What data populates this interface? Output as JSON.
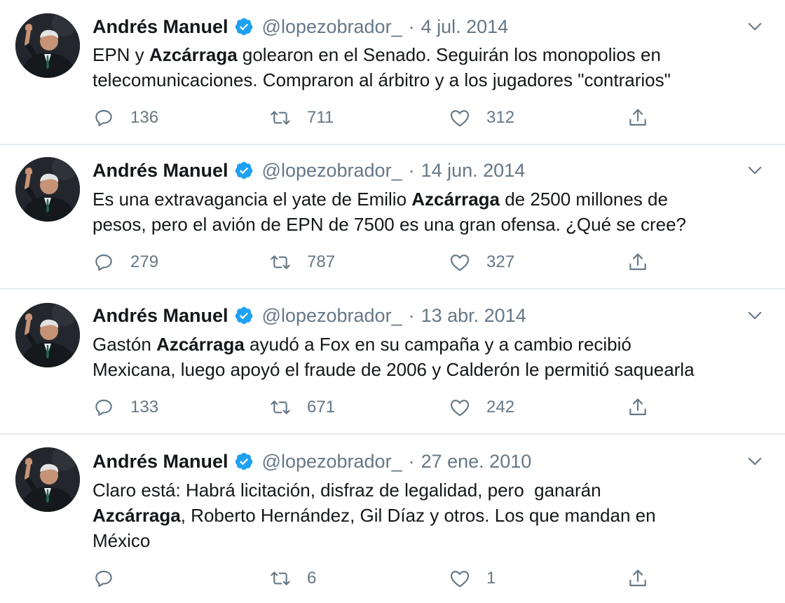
{
  "tweets": [
    {
      "author": "Andrés Manuel",
      "handle": "@lopezobrador_",
      "separator": "·",
      "date": "4 jul. 2014",
      "text": [
        {
          "t": "EPN y ",
          "b": false
        },
        {
          "t": "Azcárraga",
          "b": true
        },
        {
          "t": " golearon en el Senado. Seguirán los monopolios en\ntelecomunicaciones. Compraron al árbitro y a los jugadores \"contrarios\"",
          "b": false
        }
      ],
      "replies": "136",
      "retweets": "711",
      "likes": "312"
    },
    {
      "author": "Andrés Manuel",
      "handle": "@lopezobrador_",
      "separator": "·",
      "date": "14 jun. 2014",
      "text": [
        {
          "t": "Es una extravagancia el yate de Emilio ",
          "b": false
        },
        {
          "t": "Azcárraga",
          "b": true
        },
        {
          "t": " de 2500 millones de\npesos, pero el avión de EPN de 7500 es una gran ofensa. ¿Qué se cree?",
          "b": false
        }
      ],
      "replies": "279",
      "retweets": "787",
      "likes": "327"
    },
    {
      "author": "Andrés Manuel",
      "handle": "@lopezobrador_",
      "separator": "·",
      "date": "13 abr. 2014",
      "text": [
        {
          "t": "Gastón ",
          "b": false
        },
        {
          "t": "Azcárraga",
          "b": true
        },
        {
          "t": " ayudó a Fox en su campaña y a cambio recibió\nMexicana, luego apoyó el fraude de 2006 y Calderón le permitió saquearla",
          "b": false
        }
      ],
      "replies": "133",
      "retweets": "671",
      "likes": "242"
    },
    {
      "author": "Andrés Manuel",
      "handle": "@lopezobrador_",
      "separator": "·",
      "date": "27 ene. 2010",
      "text": [
        {
          "t": "Claro está: Habrá licitación, disfraz de legalidad, pero  ganarán\n",
          "b": false
        },
        {
          "t": "Azcárraga",
          "b": true
        },
        {
          "t": ", Roberto Hernández, Gil Díaz y otros. Los que mandan en\nMéxico",
          "b": false
        }
      ],
      "replies": "",
      "retweets": "6",
      "likes": "1"
    }
  ],
  "colors": {
    "verified": "#1da1f2",
    "muted": "#657786",
    "divider": "#e6ecf0"
  },
  "icons": [
    "verified-badge-icon",
    "chevron-down-icon",
    "reply-icon",
    "retweet-icon",
    "like-icon",
    "share-icon"
  ]
}
